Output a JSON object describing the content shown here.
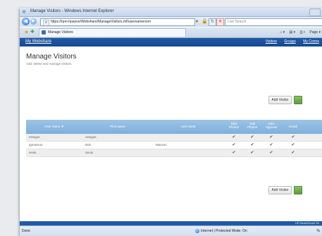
{
  "window": {
    "title": "Manage Visitors - Windows Internet Explorer"
  },
  "addressbar": {
    "url": "https://rpm-hpaove/Webshare/ManageVisitors.mf/usernamenorn",
    "search_placeholder": "Live Search"
  },
  "tab": {
    "label": "Manage Visitors"
  },
  "commandbar": {
    "page_label": "Page ▾"
  },
  "site": {
    "brand": "My Webshare",
    "links": [
      "Visitors",
      "Groups",
      "My Conne"
    ]
  },
  "page": {
    "title": "Manage Visitors",
    "subtitle": "Add, delete and manage visitors.",
    "add_visitor_top": "Add Visitor",
    "add_visitor_bottom": "Add Visitor"
  },
  "table": {
    "headers": {
      "username": "User name ▼",
      "firstname": "First name",
      "lastname": "Last name",
      "take": "Take\nPhotos",
      "add": "Add\nPhotos",
      "auto": "Auto-\nApprove",
      "email": "Email"
    },
    "rows": [
      {
        "username": "newgus",
        "firstname": "newgus",
        "lastname": "",
        "checks": [
          "✔",
          "✔",
          "✔",
          "✔"
        ]
      },
      {
        "username": "tgmasson",
        "firstname": "Bob",
        "lastname": "Masson",
        "checks": [
          "✔",
          "✔",
          "✔",
          "✔"
        ]
      },
      {
        "username": "sesie",
        "firstname": "Sesie",
        "lastname": "",
        "checks": [
          "✔",
          "✔",
          "✔",
          "✔"
        ]
      }
    ]
  },
  "footer": {
    "text": "HP MediaSmart Se"
  },
  "statusbar": {
    "left": "Done",
    "zone": "Internet | Protected Mode: On",
    "zoom": "%"
  }
}
